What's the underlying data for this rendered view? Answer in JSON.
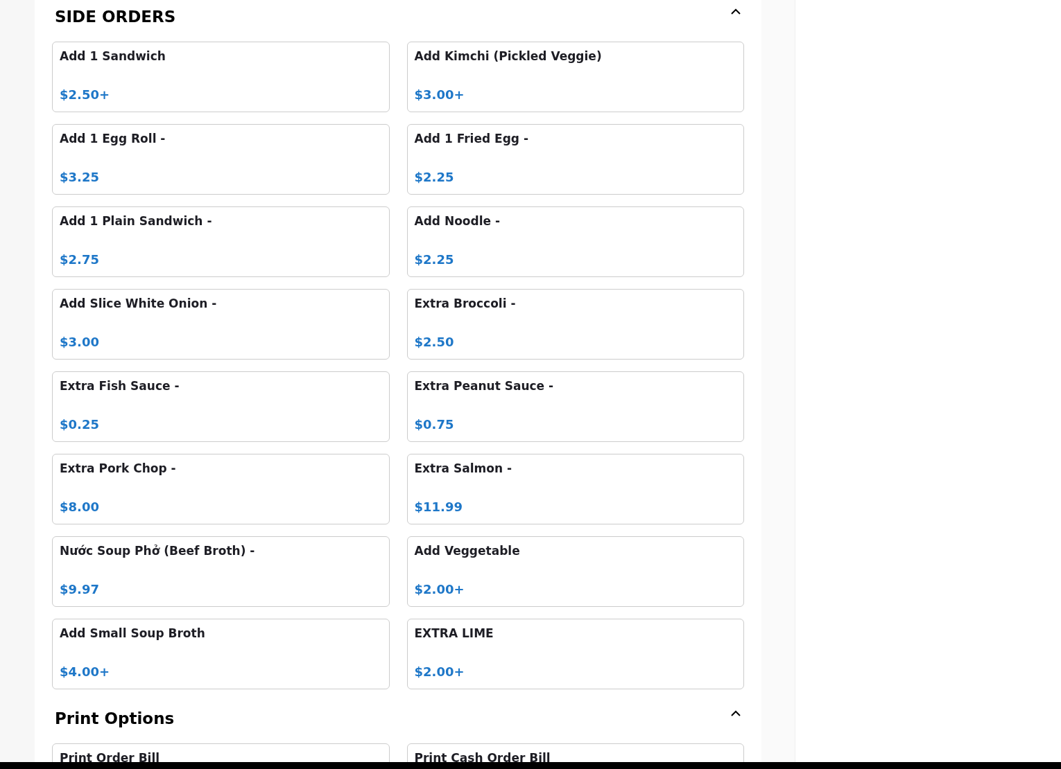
{
  "sections": [
    {
      "title": "SIDE ORDERS",
      "expanded": true,
      "items": [
        {
          "name": "Add 1 Sandwich",
          "price": "$2.50+"
        },
        {
          "name": "Add Kimchi (Pickled Veggie)",
          "price": "$3.00+"
        },
        {
          "name": "Add 1 Egg Roll -",
          "price": "$3.25"
        },
        {
          "name": "Add 1 Fried Egg -",
          "price": "$2.25"
        },
        {
          "name": "Add 1 Plain Sandwich -",
          "price": "$2.75"
        },
        {
          "name": "Add Noodle -",
          "price": "$2.25"
        },
        {
          "name": "Add Slice White Onion -",
          "price": "$3.00"
        },
        {
          "name": "Extra Broccoli -",
          "price": "$2.50"
        },
        {
          "name": "Extra Fish Sauce -",
          "price": "$0.25"
        },
        {
          "name": "Extra Peanut Sauce -",
          "price": "$0.75"
        },
        {
          "name": "Extra Pork Chop -",
          "price": "$8.00"
        },
        {
          "name": "Extra Salmon -",
          "price": "$11.99"
        },
        {
          "name": "Nước Soup Phở (Beef Broth) -",
          "price": "$9.97"
        },
        {
          "name": "Add Veggetable",
          "price": "$2.00+"
        },
        {
          "name": "Add Small Soup Broth",
          "price": "$4.00+"
        },
        {
          "name": "EXTRA LIME",
          "price": "$2.00+"
        }
      ]
    },
    {
      "title": "Print Options",
      "expanded": true,
      "items": [
        {
          "name": "Print Order Bill"
        },
        {
          "name": "Print Cash Order Bill"
        }
      ]
    }
  ]
}
